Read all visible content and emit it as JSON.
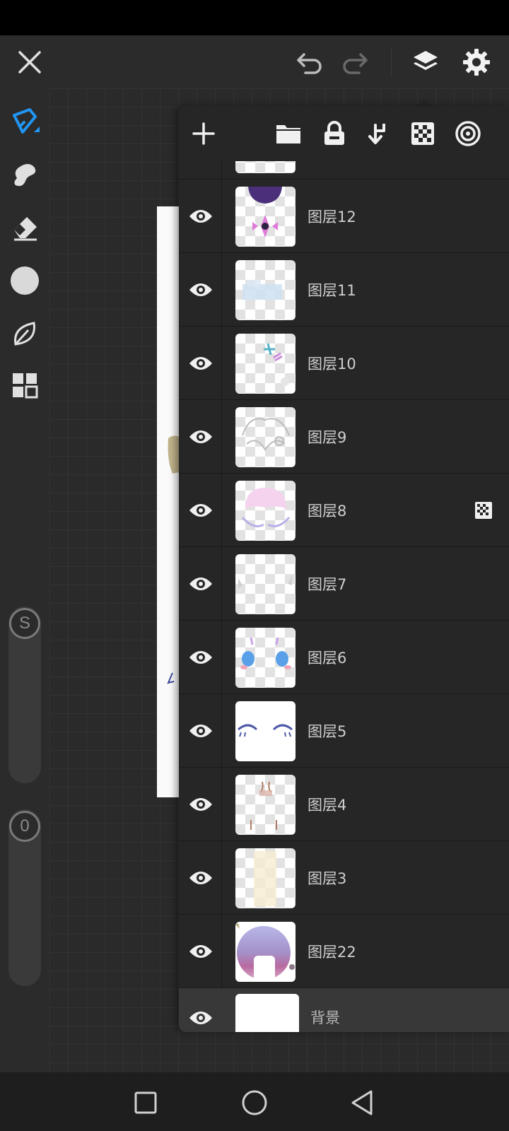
{
  "app": {
    "colors": {
      "accent": "#2196f3",
      "panel": "#262626",
      "toolbar": "#2b2b2b"
    }
  },
  "top_bar": {
    "icons": [
      "close-icon",
      "undo-icon",
      "redo-icon",
      "layers-icon",
      "settings-icon"
    ]
  },
  "left_toolbar": {
    "tools": [
      "brush-icon",
      "smudge-icon",
      "eraser-icon",
      "color-swatch",
      "leaf-icon",
      "grid-icon"
    ],
    "size_slider_label": "S",
    "opacity_slider_label": "0"
  },
  "layers_panel": {
    "toolbar_icons": [
      "add-layer-icon",
      "folder-icon",
      "lock-icon",
      "merge-down-icon",
      "checker-icon",
      "target-icon"
    ],
    "layers": [
      {
        "name": "图层12",
        "visible": true
      },
      {
        "name": "图层11",
        "visible": true
      },
      {
        "name": "图层10",
        "visible": true
      },
      {
        "name": "图层9",
        "visible": true
      },
      {
        "name": "图层8",
        "visible": true,
        "alpha_locked": true
      },
      {
        "name": "图层7",
        "visible": true
      },
      {
        "name": "图层6",
        "visible": true
      },
      {
        "name": "图层5",
        "visible": true
      },
      {
        "name": "图层4",
        "visible": true
      },
      {
        "name": "图层3",
        "visible": true
      },
      {
        "name": "图层22",
        "visible": true
      },
      {
        "name": "背景",
        "visible": true,
        "selected": true
      }
    ]
  },
  "nav_bar": {
    "icons": [
      "recent-apps-icon",
      "home-icon",
      "back-icon"
    ]
  }
}
